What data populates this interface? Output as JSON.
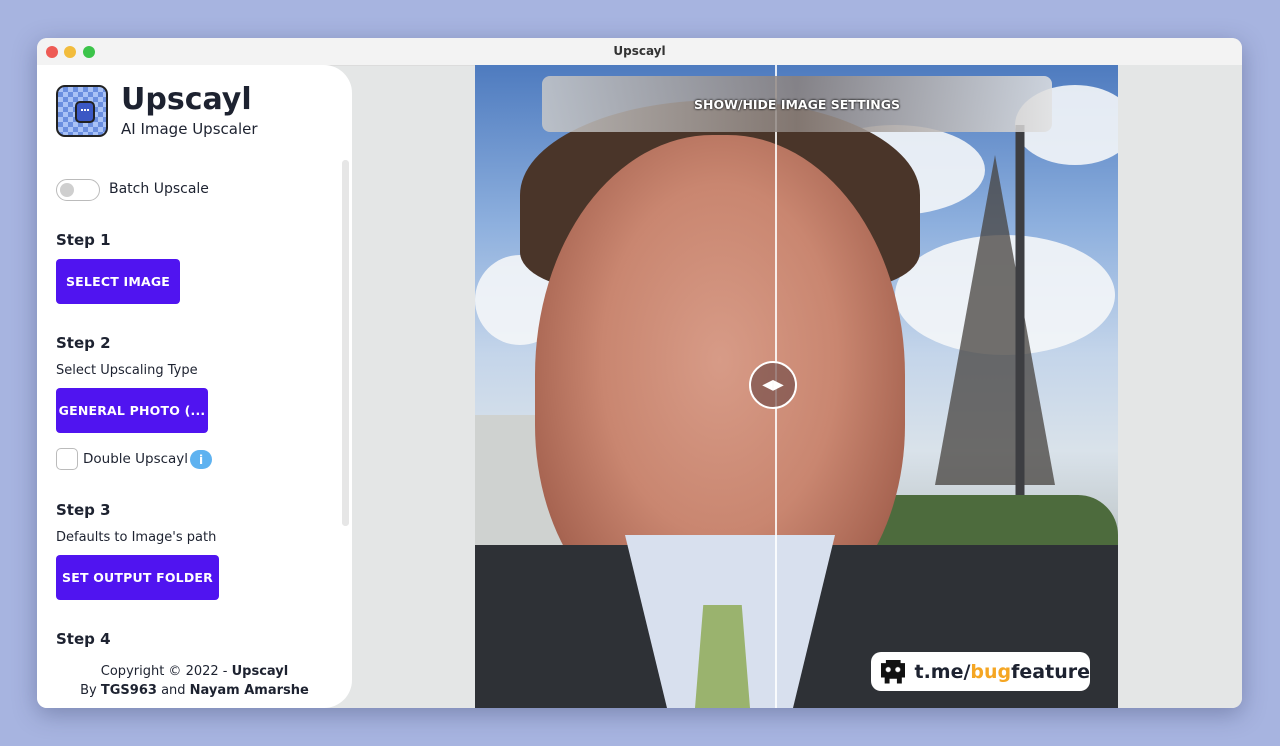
{
  "window": {
    "title": "Upscayl"
  },
  "app": {
    "name": "Upscayl",
    "subtitle": "AI Image Upscaler"
  },
  "batch": {
    "label": "Batch Upscale",
    "enabled": false
  },
  "step1": {
    "title": "Step 1",
    "button": "SELECT IMAGE"
  },
  "step2": {
    "title": "Step 2",
    "description": "Select Upscaling Type",
    "button": "GENERAL PHOTO (...",
    "double_label": "Double Upscayl",
    "double_checked": false,
    "info_icon": "i"
  },
  "step3": {
    "title": "Step 3",
    "description": "Defaults to Image's path",
    "button": "SET OUTPUT FOLDER"
  },
  "step4": {
    "title": "Step 4"
  },
  "footer": {
    "line1_prefix": "Copyright © 2022 - ",
    "line1_brand": "Upscayl",
    "line2_by": "By ",
    "author1": "TGS963",
    "and": " and ",
    "author2": "Nayam Amarshe"
  },
  "viewer": {
    "settings_button": "SHOW/HIDE IMAGE SETTINGS",
    "badge": {
      "prefix": "t.me/",
      "accent": "bug",
      "suffix": "feature"
    }
  },
  "colors": {
    "primary": "#5014f0",
    "accent": "#f5a623",
    "info": "#5eb2f0"
  },
  "icons": [
    "app-logo-icon",
    "info-icon",
    "compare-handle-icon",
    "bug-icon"
  ]
}
